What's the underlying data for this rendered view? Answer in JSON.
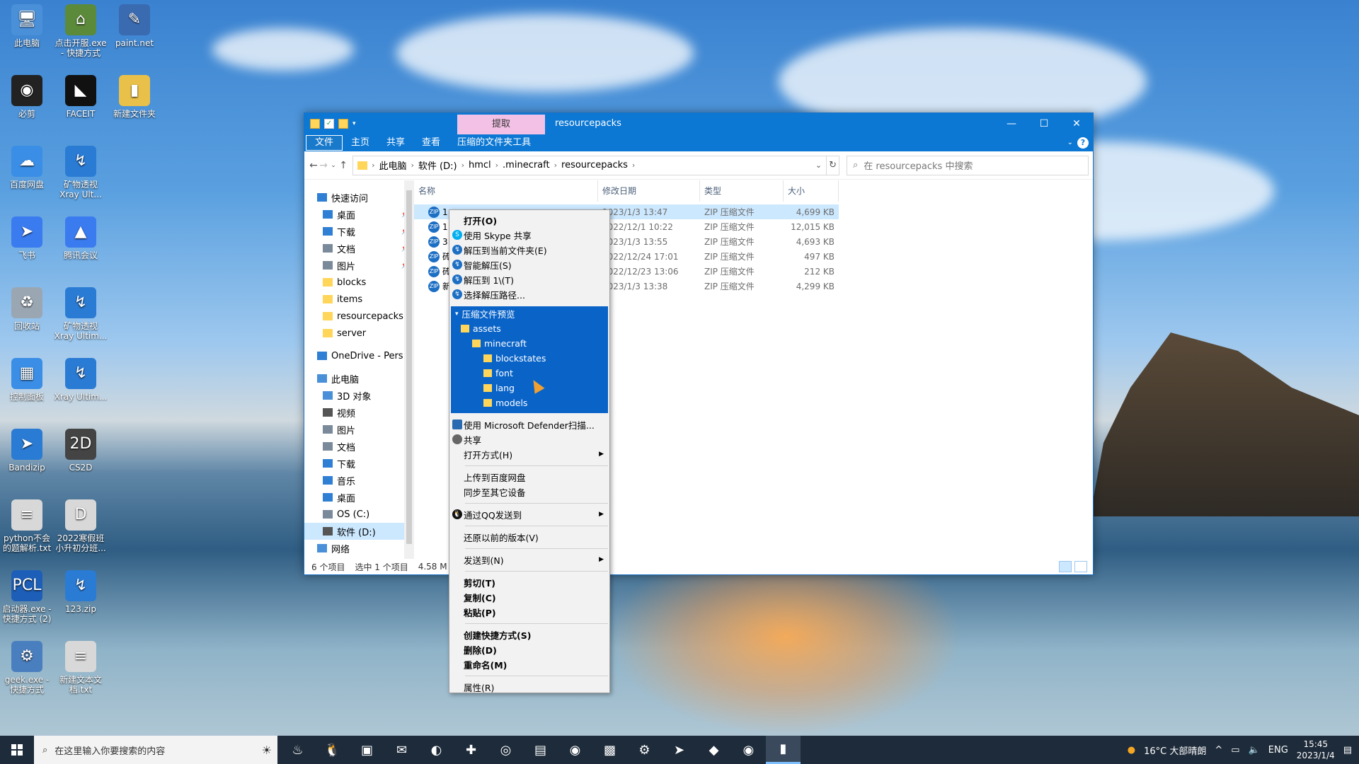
{
  "desktop": {
    "icons": [
      {
        "label": "此电脑",
        "glyph": "🖥",
        "color": "#4a90d9"
      },
      {
        "label": "点击开服.exe - 快捷方式",
        "glyph": "⌂",
        "color": "#5b8a3a"
      },
      {
        "label": "paint.net",
        "glyph": "✎",
        "color": "#3a6ab0"
      },
      {
        "label": "必剪",
        "glyph": "◉",
        "color": "#222222"
      },
      {
        "label": "FACEIT",
        "glyph": "◣",
        "color": "#111111"
      },
      {
        "label": "新建文件夹",
        "glyph": "▮",
        "color": "#e8c04a"
      },
      {
        "label": "百度网盘",
        "glyph": "☁",
        "color": "#3a8ee6"
      },
      {
        "label": "矿物透视 Xray Ult...",
        "glyph": "↯",
        "color": "#2a7bd4"
      },
      {
        "label": "飞书",
        "glyph": "➤",
        "color": "#3a7bf0"
      },
      {
        "label": "腾讯会议",
        "glyph": "▲",
        "color": "#3a7bf0"
      },
      {
        "label": "回收站",
        "glyph": "♻",
        "color": "#9aa7b3"
      },
      {
        "label": "矿物透视 Xray Ultim...",
        "glyph": "↯",
        "color": "#2a7bd4"
      },
      {
        "label": "控制面板",
        "glyph": "▦",
        "color": "#3a8ee6"
      },
      {
        "label": "Xray Ultim...",
        "glyph": "↯",
        "color": "#2a7bd4"
      },
      {
        "label": "Bandizip",
        "glyph": "➤",
        "color": "#2a7bd4"
      },
      {
        "label": "CS2D",
        "glyph": "2D",
        "color": "#444444"
      },
      {
        "label": "python不会的题解析.txt",
        "glyph": "≡",
        "color": "#d8d8d8"
      },
      {
        "label": "2022寒假班小升初分班...",
        "glyph": "D",
        "color": "#d8d8d8"
      },
      {
        "label": "启动器.exe - 快捷方式 (2)",
        "glyph": "PCL",
        "color": "#1d5fb8"
      },
      {
        "label": "123.zip",
        "glyph": "↯",
        "color": "#2a7bd4"
      },
      {
        "label": "geek.exe - 快捷方式",
        "glyph": "⚙",
        "color": "#4a7fbf"
      },
      {
        "label": "新建文本文档.txt",
        "glyph": "≡",
        "color": "#d8d8d8"
      }
    ]
  },
  "window": {
    "extract_tab": "提取",
    "title": "resourcepacks",
    "caption": {
      "minimize": "—",
      "maximize": "☐",
      "close": "✕"
    },
    "ribbon": [
      "文件",
      "主页",
      "共享",
      "查看",
      "压缩的文件夹工具"
    ],
    "help": "?",
    "address": {
      "crumbs": [
        "此电脑",
        "软件 (D:)",
        "hmcl",
        ".minecraft",
        "resourcepacks"
      ],
      "separator": "›"
    },
    "search_placeholder": "在 resourcepacks 中搜索",
    "nav": [
      {
        "label": "快速访问",
        "pin": "",
        "color": "#2f7fd4"
      },
      {
        "label": "桌面",
        "pin": "📌",
        "color": "#2f7fd4"
      },
      {
        "label": "下载",
        "pin": "📌",
        "color": "#2f7fd4"
      },
      {
        "label": "文档",
        "pin": "📌",
        "color": "#7a8a9a"
      },
      {
        "label": "图片",
        "pin": "📌",
        "color": "#7a8a9a"
      },
      {
        "label": "blocks",
        "pin": "",
        "color": "#ffd65a"
      },
      {
        "label": "items",
        "pin": "",
        "color": "#ffd65a"
      },
      {
        "label": "resourcepacks",
        "pin": "",
        "color": "#ffd65a"
      },
      {
        "label": "server",
        "pin": "",
        "color": "#ffd65a"
      },
      {
        "label": "OneDrive - Pers...",
        "pin": "",
        "color": "#2f7fd4"
      },
      {
        "label": "此电脑",
        "pin": "",
        "color": "#4a90d9"
      },
      {
        "label": "3D 对象",
        "pin": "",
        "color": "#4a90d9"
      },
      {
        "label": "视频",
        "pin": "",
        "color": "#555555"
      },
      {
        "label": "图片",
        "pin": "",
        "color": "#7a8a9a"
      },
      {
        "label": "文档",
        "pin": "",
        "color": "#7a8a9a"
      },
      {
        "label": "下载",
        "pin": "",
        "color": "#2f7fd4"
      },
      {
        "label": "音乐",
        "pin": "",
        "color": "#2f7fd4"
      },
      {
        "label": "桌面",
        "pin": "",
        "color": "#2f7fd4"
      },
      {
        "label": "OS (C:)",
        "pin": "",
        "color": "#7a8a9a"
      },
      {
        "label": "软件 (D:)",
        "pin": "",
        "color": "#555555"
      },
      {
        "label": "网络",
        "pin": "",
        "color": "#4a90d9"
      }
    ],
    "columns": [
      "名称",
      "修改日期",
      "类型",
      "大小"
    ],
    "files": [
      {
        "name": "1",
        "date": "2023/1/3 13:47",
        "type": "ZIP 压缩文件",
        "size": "4,699 KB"
      },
      {
        "name": "1",
        "date": "2022/12/1 10:22",
        "type": "ZIP 压缩文件",
        "size": "12,015 KB"
      },
      {
        "name": "3",
        "date": "2023/1/3 13:55",
        "type": "ZIP 压缩文件",
        "size": "4,693 KB"
      },
      {
        "name": "砖",
        "date": "2022/12/24 17:01",
        "type": "ZIP 压缩文件",
        "size": "497 KB"
      },
      {
        "name": "砖",
        "date": "2022/12/23 13:06",
        "type": "ZIP 压缩文件",
        "size": "212 KB"
      },
      {
        "name": "新",
        "date": "2023/1/3 13:38",
        "type": "ZIP 压缩文件",
        "size": "4,299 KB"
      }
    ],
    "status": {
      "count": "6 个项目",
      "selected": "选中 1 个项目",
      "size": "4.58 M"
    }
  },
  "context_menu": {
    "group1": [
      {
        "label": "打开(O)",
        "icon": "",
        "bold": true
      },
      {
        "label": "使用 Skype 共享",
        "icon": "S"
      },
      {
        "label": "解压到当前文件夹(E)",
        "icon": "↯"
      },
      {
        "label": "智能解压(S)",
        "icon": "↯"
      },
      {
        "label": "解压到 1\\(T)",
        "icon": "↯"
      },
      {
        "label": "选择解压路径...",
        "icon": "↯"
      }
    ],
    "preview": {
      "header": "压缩文件预览",
      "tree": [
        {
          "label": "assets",
          "level": 0
        },
        {
          "label": "minecraft",
          "level": 1
        },
        {
          "label": "blockstates",
          "level": 2
        },
        {
          "label": "font",
          "level": 2
        },
        {
          "label": "lang",
          "level": 2
        },
        {
          "label": "models",
          "level": 2
        }
      ]
    },
    "group2": [
      {
        "label": "使用 Microsoft Defender扫描...",
        "arrow": ""
      },
      {
        "label": "共享",
        "arrow": ""
      },
      {
        "label": "打开方式(H)",
        "arrow": "▶"
      }
    ],
    "group3": [
      {
        "label": "上传到百度网盘"
      },
      {
        "label": "同步至其它设备"
      }
    ],
    "qq": {
      "label": "通过QQ发送到",
      "arrow": "▶"
    },
    "restore": "还原以前的版本(V)",
    "sendto": {
      "label": "发送到(N)",
      "arrow": "▶"
    },
    "group4": [
      "剪切(T)",
      "复制(C)",
      "粘贴(P)"
    ],
    "group5": [
      "创建快捷方式(S)",
      "删除(D)",
      "重命名(M)"
    ],
    "properties": "属性(R)"
  },
  "taskbar": {
    "search_placeholder": "在这里输入你要搜索的内容",
    "apps": [
      "steam",
      "qq",
      "box",
      "wechat",
      "edge",
      "cube",
      "obs",
      "bili",
      "chrome",
      "minecraft",
      "gear",
      "feishu",
      "folder-game",
      "bijian",
      "explorer"
    ],
    "app_glyphs": [
      "♨",
      "🐧",
      "▣",
      "✉",
      "◐",
      "✚",
      "◎",
      "▤",
      "◉",
      "▩",
      "⚙",
      "➤",
      "◆",
      "◉",
      "▮"
    ],
    "weather": "16°C  大部晴朗",
    "lang": "ENG",
    "time": "15:45",
    "date": "2023/1/4"
  }
}
